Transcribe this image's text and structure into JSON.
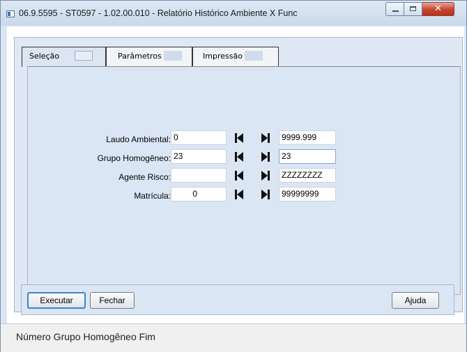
{
  "window": {
    "title": "06.9.5595 - ST0597 - 1.02.00.010 - Relatório Histórico Ambiente X Func",
    "close_glyph": "✕"
  },
  "tabs": [
    {
      "label": "Seleção",
      "active": true
    },
    {
      "label": "Parâmetros",
      "active": false
    },
    {
      "label": "Impressão",
      "active": false
    }
  ],
  "form": {
    "rows": [
      {
        "label": "Laudo Ambiental:",
        "from": "0",
        "to": "9999.999"
      },
      {
        "label": "Grupo Homogêneo:",
        "from": "23",
        "to": "23"
      },
      {
        "label": "Agente Risco:",
        "from": "",
        "to": "ZZZZZZZZ"
      },
      {
        "label": "Matrícula:",
        "from": "0",
        "to": "99999999"
      }
    ],
    "icons": {
      "first": "first-record-icon",
      "last": "last-record-icon"
    }
  },
  "buttons": {
    "execute": "Executar",
    "close": "Fechar",
    "help": "Ajuda"
  },
  "status": {
    "text": "Número Grupo Homogêneo Fim"
  },
  "colors": {
    "panel": "#dbe6f4",
    "close_button": "#c7432c",
    "focus_border": "#3b83c8"
  }
}
